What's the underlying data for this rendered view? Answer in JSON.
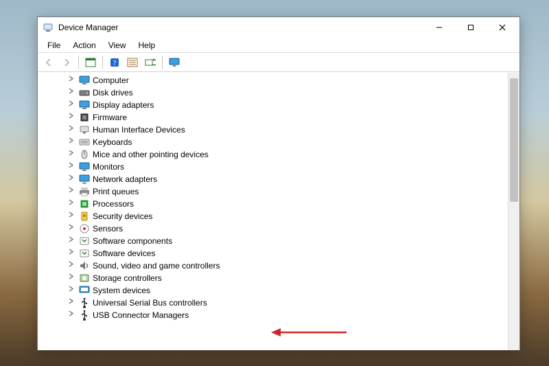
{
  "window": {
    "title": "Device Manager"
  },
  "menubar": {
    "items": [
      "File",
      "Action",
      "View",
      "Help"
    ]
  },
  "toolbar": {
    "back": "Back",
    "forward": "Forward",
    "show_hidden": "Show hidden devices",
    "help": "Help",
    "properties": "Properties",
    "update": "Update driver",
    "scan": "Scan for hardware changes"
  },
  "tree": {
    "nodes": [
      {
        "label": "Computer",
        "icon": "monitor"
      },
      {
        "label": "Disk drives",
        "icon": "disk"
      },
      {
        "label": "Display adapters",
        "icon": "monitor"
      },
      {
        "label": "Firmware",
        "icon": "chip"
      },
      {
        "label": "Human Interface Devices",
        "icon": "hid"
      },
      {
        "label": "Keyboards",
        "icon": "keyboard"
      },
      {
        "label": "Mice and other pointing devices",
        "icon": "mouse"
      },
      {
        "label": "Monitors",
        "icon": "monitor"
      },
      {
        "label": "Network adapters",
        "icon": "network"
      },
      {
        "label": "Print queues",
        "icon": "printer"
      },
      {
        "label": "Processors",
        "icon": "cpu"
      },
      {
        "label": "Security devices",
        "icon": "security"
      },
      {
        "label": "Sensors",
        "icon": "sensor"
      },
      {
        "label": "Software components",
        "icon": "software"
      },
      {
        "label": "Software devices",
        "icon": "software"
      },
      {
        "label": "Sound, video and game controllers",
        "icon": "sound"
      },
      {
        "label": "Storage controllers",
        "icon": "storage"
      },
      {
        "label": "System devices",
        "icon": "system"
      },
      {
        "label": "Universal Serial Bus controllers",
        "icon": "usb"
      },
      {
        "label": "USB Connector Managers",
        "icon": "usb"
      }
    ],
    "highlighted_index": 15
  },
  "annotation": {
    "type": "arrow",
    "color": "#d22424"
  }
}
